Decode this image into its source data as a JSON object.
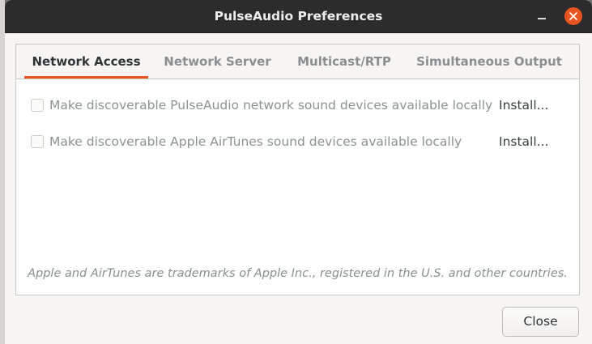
{
  "window": {
    "title": "PulseAudio Preferences"
  },
  "tabs": [
    {
      "label": "Network Access",
      "active": true
    },
    {
      "label": "Network Server",
      "active": false
    },
    {
      "label": "Multicast/RTP",
      "active": false
    },
    {
      "label": "Simultaneous Output",
      "active": false
    }
  ],
  "options": [
    {
      "label": "Make discoverable PulseAudio network sound devices available locally",
      "checked": false,
      "install_label": "Install..."
    },
    {
      "label": "Make discoverable Apple AirTunes sound devices available locally",
      "checked": false,
      "install_label": "Install..."
    }
  ],
  "footer": {
    "trademark": "Apple and AirTunes are trademarks of Apple Inc., registered in the U.S. and other countries.",
    "close_label": "Close"
  },
  "colors": {
    "accent": "#e95420",
    "titlebar": "#2c2c2c"
  }
}
